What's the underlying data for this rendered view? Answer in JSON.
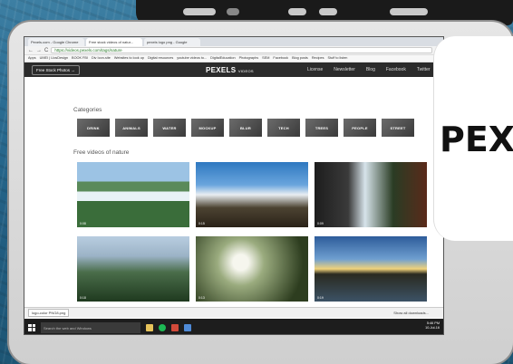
{
  "phone": {
    "indicator": "≡"
  },
  "browser": {
    "tabs": [
      "Pexels.com - Google Chrome",
      "Free stock videos of natur...",
      "pexels logo png - Google"
    ],
    "url": "https://videos.pexels.com/tags/nature",
    "bookmarks": [
      "Apps",
      "UMEI | LlosDesign",
      "BOOK FBI",
      "Div Icon-site",
      "Websites to look up",
      "Digital resources",
      "youtube videos to...",
      "DigitalEducation",
      "Photographs",
      "SEM",
      "Facebook",
      "Blog posts",
      "Recipes",
      "Stuff to listen"
    ]
  },
  "pexels": {
    "browse_button": "Free Stock Photos →",
    "logo": "PEXELS",
    "logo_sub": "VIDEOS",
    "nav": [
      "License",
      "Newsletter",
      "Blog",
      "Facebook",
      "Twitter"
    ],
    "categories_title": "Categories",
    "categories": [
      "DRINK",
      "ANIMALS",
      "WATER",
      "MOCKUP",
      "BLUR",
      "TECH",
      "TREES",
      "PEOPLE",
      "STREET"
    ],
    "videos_title": "Free videos of nature",
    "durations": [
      "0:08",
      "0:15",
      "0:09",
      "0:18",
      "0:13",
      "0:19"
    ]
  },
  "downloads": {
    "file": "logo-color PNG8.png",
    "show_all": "Show all downloads..."
  },
  "taskbar": {
    "search": "Search the web and Windows",
    "time": "5:46 PM",
    "date": "10-Jul-16"
  },
  "card": {
    "text": "PEX"
  }
}
